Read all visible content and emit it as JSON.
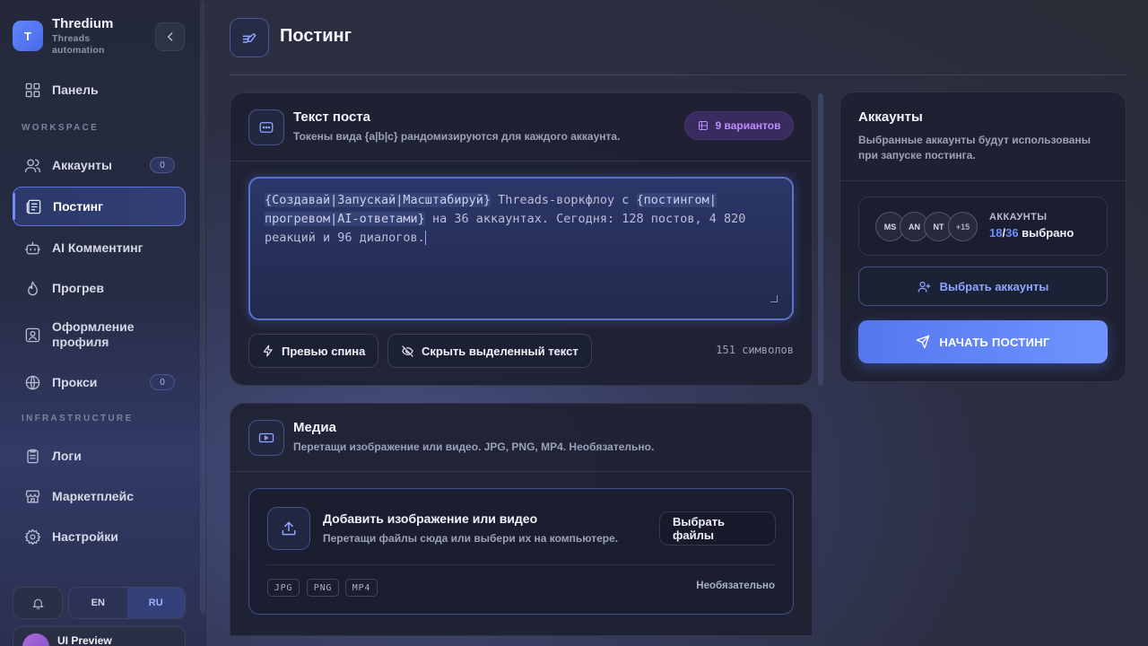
{
  "brand": {
    "logo_letter": "T",
    "name": "Thredium",
    "subtitle_line1": "Threads",
    "subtitle_line2": "automation"
  },
  "sidebar": {
    "panel": "Панель",
    "section_workspace": "WORKSPACE",
    "accounts": {
      "label": "Аккаунты",
      "badge": "0"
    },
    "posting": "Постинг",
    "ai_commenting": "AI Комментинг",
    "warmup": "Прогрев",
    "profile_line1": "Оформление",
    "profile_line2": "профиля",
    "proxy": {
      "label": "Прокси",
      "badge": "0"
    },
    "section_infra": "INFRASTRUCTURE",
    "logs": "Логи",
    "marketplace": "Маркетплейс",
    "settings": "Настройки",
    "lang_en": "EN",
    "lang_ru": "RU",
    "user_name": "UI Preview"
  },
  "page": {
    "title": "Постинг"
  },
  "post_card": {
    "title": "Текст поста",
    "subtitle": "Токены вида {a|b|c} рандомизируются для каждого аккаунта.",
    "variants_badge": "9  вариантов",
    "text_token1": "{Создавай|Запускай|Масштабируй}",
    "text_part1": " Threads-воркфлоу с ",
    "text_token2": "{постингом|прогревом|AI-ответами}",
    "text_part2": " на 36 аккаунтах. Сегодня: 128 постов, 4 820 реакций и 96 диалогов.",
    "preview_btn": "Превью спина",
    "hide_btn": "Скрыть выделенный текст",
    "char_count": "151 символов"
  },
  "media_card": {
    "title": "Медиа",
    "subtitle": "Перетащи изображение или видео. JPG, PNG, MP4. Необязательно.",
    "drop_title": "Добавить изображение или видео",
    "drop_sub": "Перетащи файлы сюда или выбери их на компьютере.",
    "choose_btn": "Выбрать файлы",
    "formats": [
      "JPG",
      "PNG",
      "MP4"
    ],
    "optional": "Необязательно"
  },
  "accounts_card": {
    "title": "Аккаунты",
    "subtitle_line1": "Выбранные аккаунты будут использованы",
    "subtitle_line2": "при запуске постинга.",
    "avatars": [
      "MS",
      "AN",
      "NT",
      "+15"
    ],
    "label": "АККАУНТЫ",
    "selected": "18",
    "sep": "/",
    "total": "36",
    "suffix": " выбрано",
    "pick_btn": "Выбрать аккаунты",
    "start_btn": "НАЧАТЬ ПОСТИНГ"
  },
  "colors": {
    "accent": "#6f8dff",
    "badge_purple": "#bf8cff",
    "start_btn": "#5b7ef0"
  }
}
